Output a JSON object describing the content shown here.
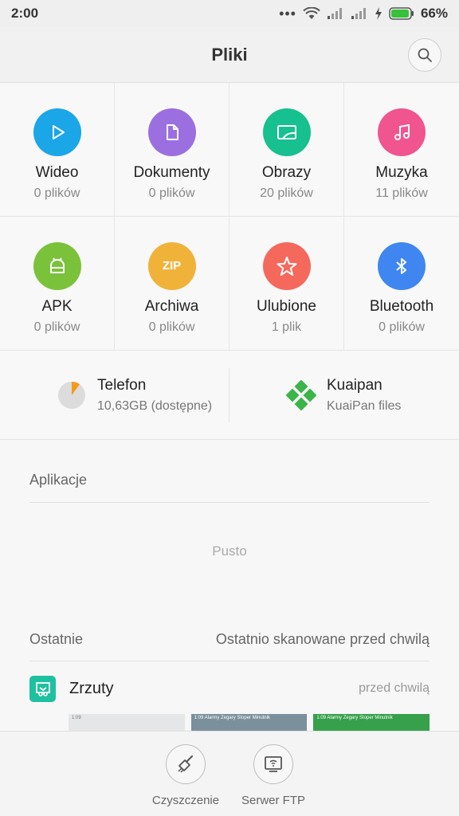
{
  "status": {
    "time": "2:00",
    "battery": "66%"
  },
  "header": {
    "title": "Pliki"
  },
  "categories": [
    {
      "label": "Wideo",
      "count": "0 plików",
      "color": "#1ba6e8",
      "icon": "play-icon"
    },
    {
      "label": "Dokumenty",
      "count": "0 plików",
      "color": "#9b6fe0",
      "icon": "document-icon"
    },
    {
      "label": "Obrazy",
      "count": "20 plików",
      "color": "#17c08f",
      "icon": "image-icon"
    },
    {
      "label": "Muzyka",
      "count": "11 plików",
      "color": "#f0558f",
      "icon": "music-icon"
    },
    {
      "label": "APK",
      "count": "0 plików",
      "color": "#7ac23a",
      "icon": "android-icon"
    },
    {
      "label": "Archiwa",
      "count": "0 plików",
      "color": "#f1b23a",
      "icon": "zip-icon"
    },
    {
      "label": "Ulubione",
      "count": "1 plik",
      "color": "#f5685c",
      "icon": "star-icon"
    },
    {
      "label": "Bluetooth",
      "count": "0 plików",
      "color": "#3f86f1",
      "icon": "bluetooth-icon"
    }
  ],
  "storage": [
    {
      "title": "Telefon",
      "subtitle": "10,63GB (dostępne)",
      "icon": "pie-chart-icon",
      "used_fraction": 0.1
    },
    {
      "title": "Kuaipan",
      "subtitle": "KuaiPan files",
      "icon": "kuaipan-icon"
    }
  ],
  "apps": {
    "title": "Aplikacje",
    "empty": "Pusto"
  },
  "recent": {
    "title": "Ostatnie",
    "scan_status": "Ostatnio skanowane przed chwilą",
    "group_name": "Zrzuty",
    "group_time": "przed chwilą"
  },
  "thumbnails": [
    {
      "color": "#e4e6e8",
      "text": "1:09"
    },
    {
      "color": "#7b8f9c",
      "text": "1:09 Alarmy Zegary Stoper Minutnik"
    },
    {
      "color": "#36a04a",
      "text": "1:09 Alarmy Zegary Stoper Minutnik"
    }
  ],
  "actions": [
    {
      "label": "Czyszczenie",
      "icon": "broom-icon"
    },
    {
      "label": "Serwer FTP",
      "icon": "ftp-icon"
    }
  ]
}
